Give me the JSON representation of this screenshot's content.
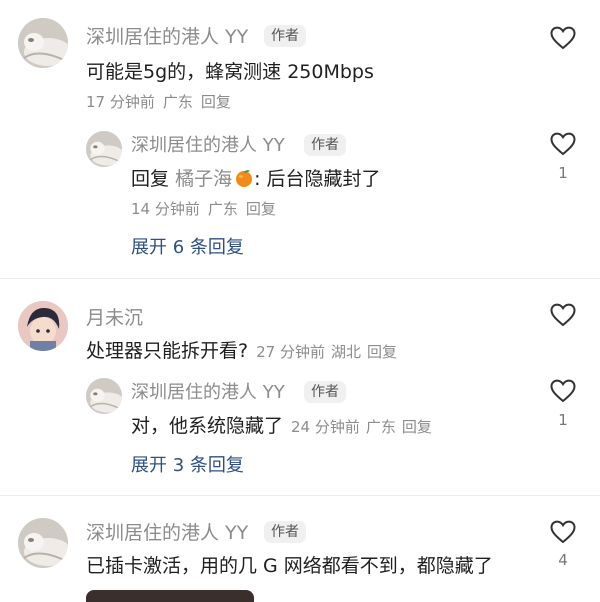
{
  "comments": [
    {
      "author": "深圳居住的港人 YY",
      "badge": "作者",
      "text": "可能是5g的，蜂窝测速 250Mbps",
      "time": "17 分钟前",
      "location": "广东",
      "reply_label": "回复",
      "likes": "",
      "replies": [
        {
          "author": "深圳居住的港人 YY",
          "badge": "作者",
          "reply_prefix": "回复",
          "reply_to": "橘子海",
          "text": ": 后台隐藏封了",
          "time": "14 分钟前",
          "location": "广东",
          "reply_label": "回复",
          "likes": "1"
        }
      ],
      "expand_label": "展开 6 条回复"
    },
    {
      "author": "月未沉",
      "text": "处理器只能拆开看?",
      "time": "27 分钟前",
      "location": "湖北",
      "reply_label": "回复",
      "likes": "",
      "replies": [
        {
          "author": "深圳居住的港人 YY",
          "badge": "作者",
          "text": "对，他系统隐藏了",
          "time": "24 分钟前",
          "location": "广东",
          "reply_label": "回复",
          "likes": "1"
        }
      ],
      "expand_label": "展开 3 条回复"
    },
    {
      "author": "深圳居住的港人 YY",
      "badge": "作者",
      "text": "已插卡激活，用的几 G 网络都看不到，都隐藏了",
      "likes": "4"
    }
  ],
  "icons": {
    "like": "heart-outline-icon",
    "emoji": "tangerine-emoji-icon"
  },
  "colors": {
    "link": "#2f4f7f",
    "muted": "#8c8c8c",
    "badge_bg": "#f0f0f0"
  }
}
